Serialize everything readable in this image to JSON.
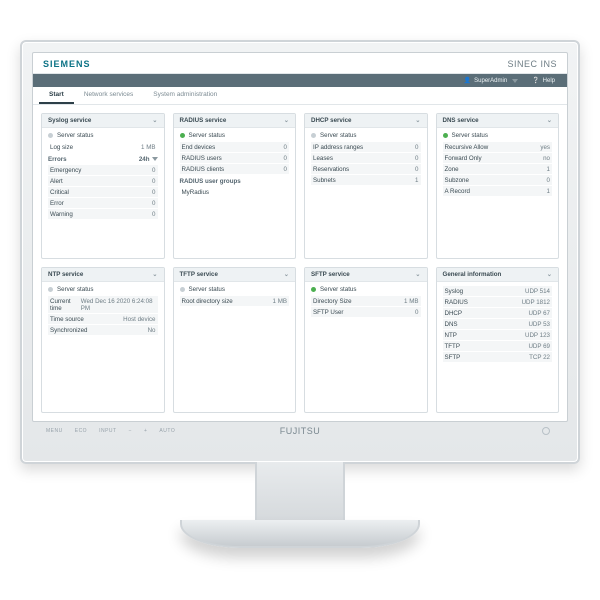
{
  "brand": "SIEMENS",
  "product": "SINEC INS",
  "monitor_brand": "FUJITSU",
  "monitor_buttons": [
    "MENU",
    "ECO",
    "INPUT",
    "−",
    "+",
    "AUTO"
  ],
  "user": {
    "name": "SuperAdmin",
    "help": "Help"
  },
  "tabs": [
    {
      "label": "Start",
      "active": true
    },
    {
      "label": "Network services",
      "active": false
    },
    {
      "label": "System administration",
      "active": false
    }
  ],
  "cards": {
    "syslog": {
      "title": "Syslog service",
      "status_label": "Server status",
      "status_on": false,
      "rows": [
        {
          "k": "Log size",
          "v": "1 MB"
        }
      ],
      "errors_head": "Errors",
      "errors_head_val": "24h",
      "errors": [
        {
          "k": "Emergency",
          "v": "0"
        },
        {
          "k": "Alert",
          "v": "0"
        },
        {
          "k": "Critical",
          "v": "0"
        },
        {
          "k": "Error",
          "v": "0"
        },
        {
          "k": "Warning",
          "v": "0"
        }
      ]
    },
    "radius": {
      "title": "RADIUS service",
      "status_label": "Server status",
      "status_on": true,
      "rows": [
        {
          "k": "End devices",
          "v": "0"
        },
        {
          "k": "RADIUS users",
          "v": "0"
        },
        {
          "k": "RADIUS clients",
          "v": "0"
        }
      ],
      "groups_head": "RADIUS user groups",
      "groups": [
        {
          "k": "MyRadius",
          "v": ""
        }
      ]
    },
    "dhcp": {
      "title": "DHCP service",
      "status_label": "Server status",
      "status_on": false,
      "rows": [
        {
          "k": "IP address ranges",
          "v": "0"
        },
        {
          "k": "Leases",
          "v": "0"
        },
        {
          "k": "Reservations",
          "v": "0"
        },
        {
          "k": "Subnets",
          "v": "1"
        }
      ]
    },
    "dns": {
      "title": "DNS service",
      "status_label": "Server status",
      "status_on": true,
      "rows": [
        {
          "k": "Recursive Allow",
          "v": "yes"
        },
        {
          "k": "Forward Only",
          "v": "no"
        },
        {
          "k": "Zone",
          "v": "1"
        },
        {
          "k": "Subzone",
          "v": "0"
        },
        {
          "k": "A Record",
          "v": "1"
        }
      ]
    },
    "ntp": {
      "title": "NTP service",
      "status_label": "Server status",
      "status_on": false,
      "rows": [
        {
          "k": "Current time",
          "v": "Wed Dec 16 2020 6:24:08 PM"
        },
        {
          "k": "Time source",
          "v": "Host device"
        },
        {
          "k": "Synchronized",
          "v": "No"
        }
      ]
    },
    "tftp": {
      "title": "TFTP service",
      "status_label": "Server status",
      "status_on": false,
      "rows": [
        {
          "k": "Root directory size",
          "v": "1 MB"
        }
      ]
    },
    "sftp": {
      "title": "SFTP service",
      "status_label": "Server status",
      "status_on": true,
      "rows": [
        {
          "k": "Directory Size",
          "v": "1 MB"
        },
        {
          "k": "SFTP User",
          "v": "0"
        }
      ]
    },
    "general": {
      "title": "General information",
      "rows": [
        {
          "k": "Syslog",
          "v": "UDP 514"
        },
        {
          "k": "RADIUS",
          "v": "UDP 1812"
        },
        {
          "k": "DHCP",
          "v": "UDP 67"
        },
        {
          "k": "DNS",
          "v": "UDP 53"
        },
        {
          "k": "NTP",
          "v": "UDP 123"
        },
        {
          "k": "TFTP",
          "v": "UDP 69"
        },
        {
          "k": "SFTP",
          "v": "TCP 22"
        }
      ]
    }
  }
}
